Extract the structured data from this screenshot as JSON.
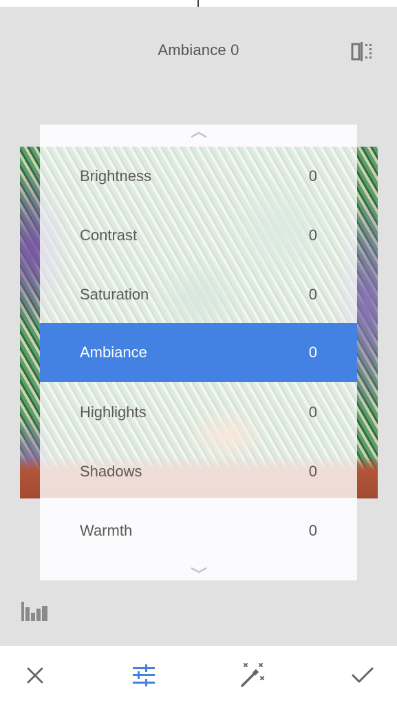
{
  "header": {
    "title": "Ambiance 0"
  },
  "menu": {
    "items": [
      {
        "label": "Brightness",
        "value": "0"
      },
      {
        "label": "Contrast",
        "value": "0"
      },
      {
        "label": "Saturation",
        "value": "0"
      },
      {
        "label": "Ambiance",
        "value": "0",
        "selected": true
      },
      {
        "label": "Highlights",
        "value": "0"
      },
      {
        "label": "Shadows",
        "value": "0"
      },
      {
        "label": "Warmth",
        "value": "0"
      }
    ]
  },
  "toolbar": {
    "icons": [
      "close-icon",
      "tune-sliders-icon",
      "magic-wand-icon",
      "check-icon"
    ],
    "accent_color": "#4381e2"
  },
  "colors": {
    "selection": "#4381e2",
    "workspace": "#e1e1e1"
  }
}
